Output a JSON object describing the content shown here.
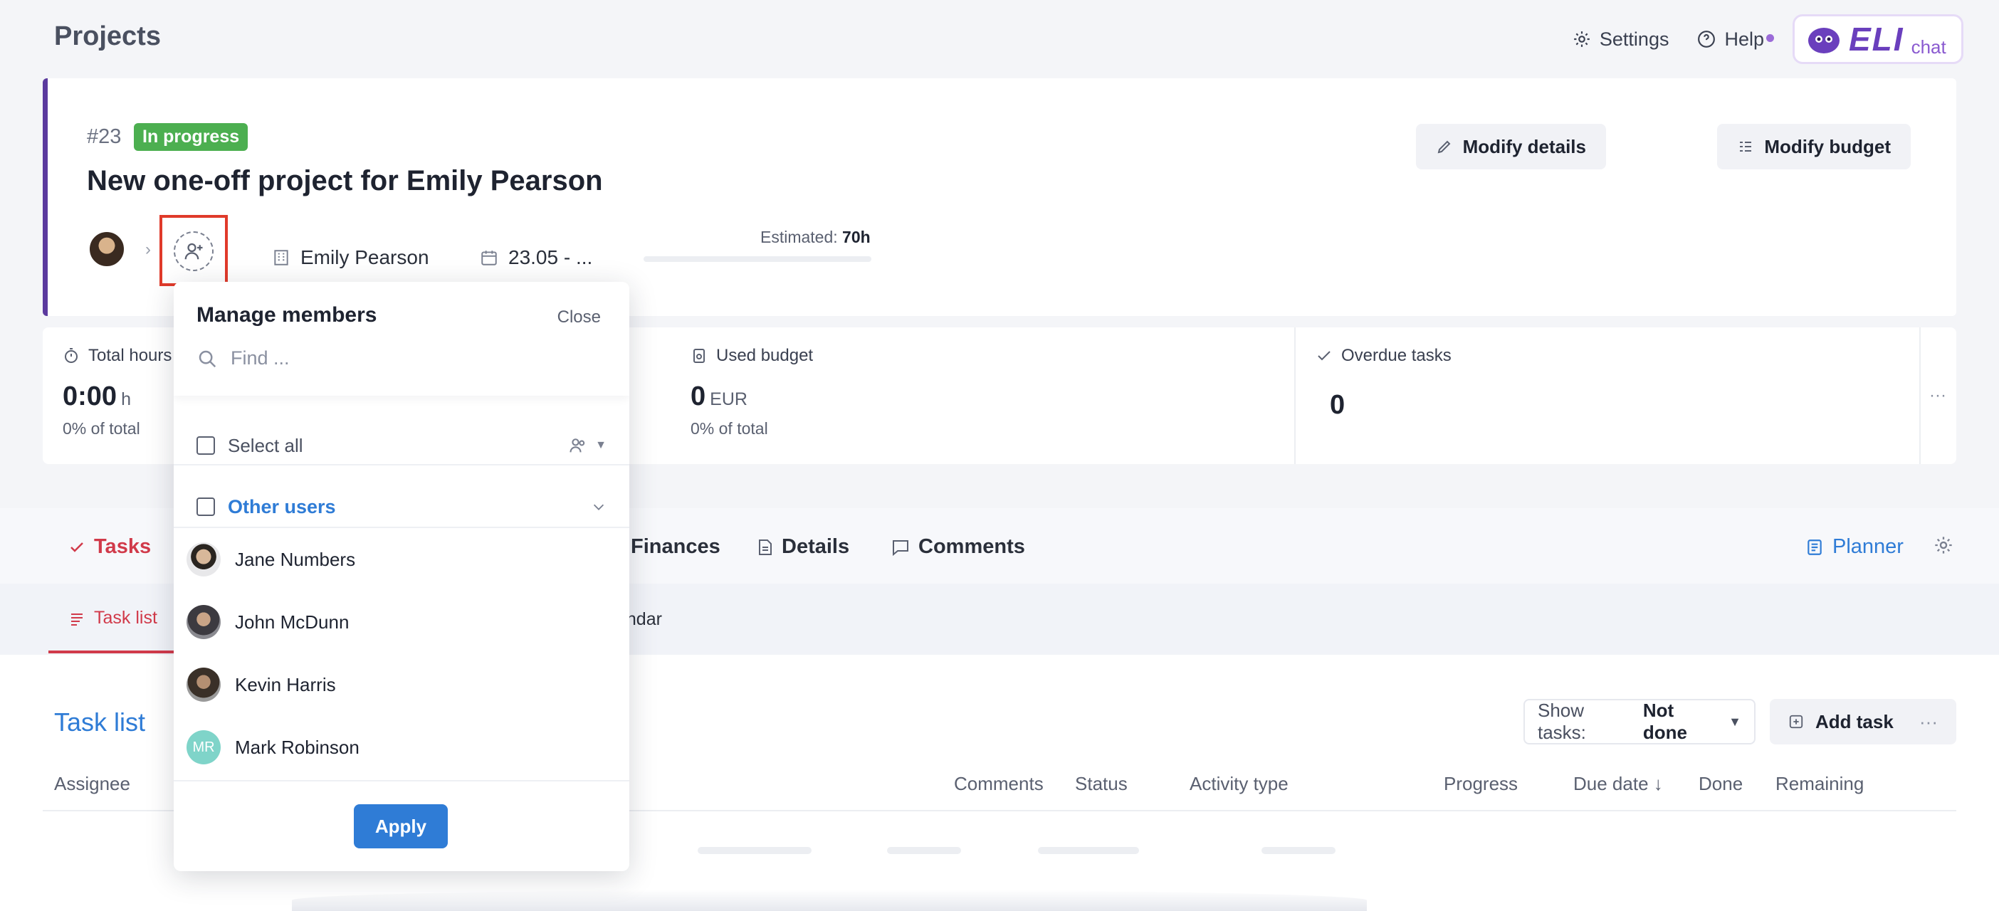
{
  "header": {
    "page_title": "Projects",
    "settings_label": "Settings",
    "help_label": "Help",
    "brand_logo": "ELI",
    "brand_chat": "chat"
  },
  "project": {
    "number": "#23",
    "status": "In progress",
    "title": "New one-off project for Emily Pearson",
    "client": "Emily Pearson",
    "date": "23.05 - ...",
    "estimated_label": "Estimated:",
    "estimated_value": "70h",
    "modify_details": "Modify details",
    "modify_budget": "Modify budget"
  },
  "stats": {
    "total_hours": {
      "label": "Total hours",
      "value": "0:00",
      "unit": "h",
      "percent": "0%",
      "sub": "of total"
    },
    "used_budget": {
      "label": "Used budget",
      "value": "0",
      "unit": "EUR",
      "percent": "0%",
      "sub": "of total"
    },
    "overdue": {
      "label": "Overdue tasks",
      "value": "0"
    }
  },
  "tabs": {
    "tasks": "Tasks",
    "finances": "Finances",
    "details": "Details",
    "comments": "Comments",
    "planner": "Planner"
  },
  "subtabs": {
    "task_list": "Task list",
    "calendar_partial": "endar"
  },
  "tasklist": {
    "title": "Task list",
    "show_tasks_label": "Show tasks:",
    "show_tasks_value": "Not done",
    "add_task": "Add task",
    "columns": {
      "assignee": "Assignee",
      "comments": "Comments",
      "status": "Status",
      "activity_type": "Activity type",
      "progress": "Progress",
      "due_date": "Due date ↓",
      "done": "Done",
      "remaining": "Remaining"
    }
  },
  "modal": {
    "title": "Manage members",
    "close": "Close",
    "search_placeholder": "Find ...",
    "select_all": "Select all",
    "group_label": "Other users",
    "users": [
      {
        "name": "Jane Numbers"
      },
      {
        "name": "John McDunn"
      },
      {
        "name": "Kevin Harris"
      },
      {
        "name": "Mark Robinson",
        "initials": "MR"
      }
    ],
    "apply": "Apply"
  },
  "colors": {
    "accent": "#2f7cd6",
    "danger": "#d13a4a",
    "success": "#4caf50",
    "brand": "#5b3a9e"
  }
}
